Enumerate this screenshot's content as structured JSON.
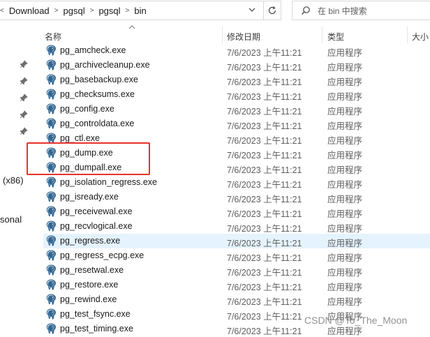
{
  "breadcrumb": [
    "Download",
    "pgsql",
    "pgsql",
    "bin"
  ],
  "search": {
    "placeholder": "在 bin 中搜索"
  },
  "nav": {
    "label_x86": "(x86)",
    "label_sonal": "sonal"
  },
  "columns": {
    "name": "名称",
    "date": "修改日期",
    "type": "类型",
    "size": "大小"
  },
  "files": [
    {
      "name": "pg_amcheck.exe",
      "date": "7/6/2023 上午11:21",
      "type": "应用程序",
      "size": ""
    },
    {
      "name": "pg_archivecleanup.exe",
      "date": "7/6/2023 上午11:21",
      "type": "应用程序",
      "size": ""
    },
    {
      "name": "pg_basebackup.exe",
      "date": "7/6/2023 上午11:21",
      "type": "应用程序",
      "size": ""
    },
    {
      "name": "pg_checksums.exe",
      "date": "7/6/2023 上午11:21",
      "type": "应用程序",
      "size": ""
    },
    {
      "name": "pg_config.exe",
      "date": "7/6/2023 上午11:21",
      "type": "应用程序",
      "size": ""
    },
    {
      "name": "pg_controldata.exe",
      "date": "7/6/2023 上午11:21",
      "type": "应用程序",
      "size": ""
    },
    {
      "name": "pg_ctl.exe",
      "date": "7/6/2023 上午11:21",
      "type": "应用程序",
      "size": ""
    },
    {
      "name": "pg_dump.exe",
      "date": "7/6/2023 上午11:21",
      "type": "应用程序",
      "size": ""
    },
    {
      "name": "pg_dumpall.exe",
      "date": "7/6/2023 上午11:21",
      "type": "应用程序",
      "size": ""
    },
    {
      "name": "pg_isolation_regress.exe",
      "date": "7/6/2023 上午11:21",
      "type": "应用程序",
      "size": ""
    },
    {
      "name": "pg_isready.exe",
      "date": "7/6/2023 上午11:21",
      "type": "应用程序",
      "size": ""
    },
    {
      "name": "pg_receivewal.exe",
      "date": "7/6/2023 上午11:21",
      "type": "应用程序",
      "size": ""
    },
    {
      "name": "pg_recvlogical.exe",
      "date": "7/6/2023 上午11:21",
      "type": "应用程序",
      "size": ""
    },
    {
      "name": "pg_regress.exe",
      "date": "7/6/2023 上午11:21",
      "type": "应用程序",
      "size": ""
    },
    {
      "name": "pg_regress_ecpg.exe",
      "date": "7/6/2023 上午11:21",
      "type": "应用程序",
      "size": ""
    },
    {
      "name": "pg_resetwal.exe",
      "date": "7/6/2023 上午11:21",
      "type": "应用程序",
      "size": ""
    },
    {
      "name": "pg_restore.exe",
      "date": "7/6/2023 上午11:21",
      "type": "应用程序",
      "size": ""
    },
    {
      "name": "pg_rewind.exe",
      "date": "7/6/2023 上午11:21",
      "type": "应用程序",
      "size": ""
    },
    {
      "name": "pg_test_fsync.exe",
      "date": "7/6/2023 上午11:21",
      "type": "应用程序",
      "size": ""
    },
    {
      "name": "pg_test_timing.exe",
      "date": "7/6/2023 上午11:21",
      "type": "应用程序",
      "size": ""
    }
  ],
  "selected_file": "pg_regress.exe",
  "highlighted_files": [
    "pg_dump.exe",
    "pg_dumpall.exe"
  ],
  "watermark": "CSDN @To_The_Moon",
  "colors": {
    "selection": "#e5f3ff",
    "highlight_border": "#e8312b",
    "elephant": "#336791"
  },
  "icons": {
    "file": "postgresql-elephant-icon",
    "search": "search-icon",
    "refresh": "refresh-icon",
    "pin": "pin-icon"
  }
}
